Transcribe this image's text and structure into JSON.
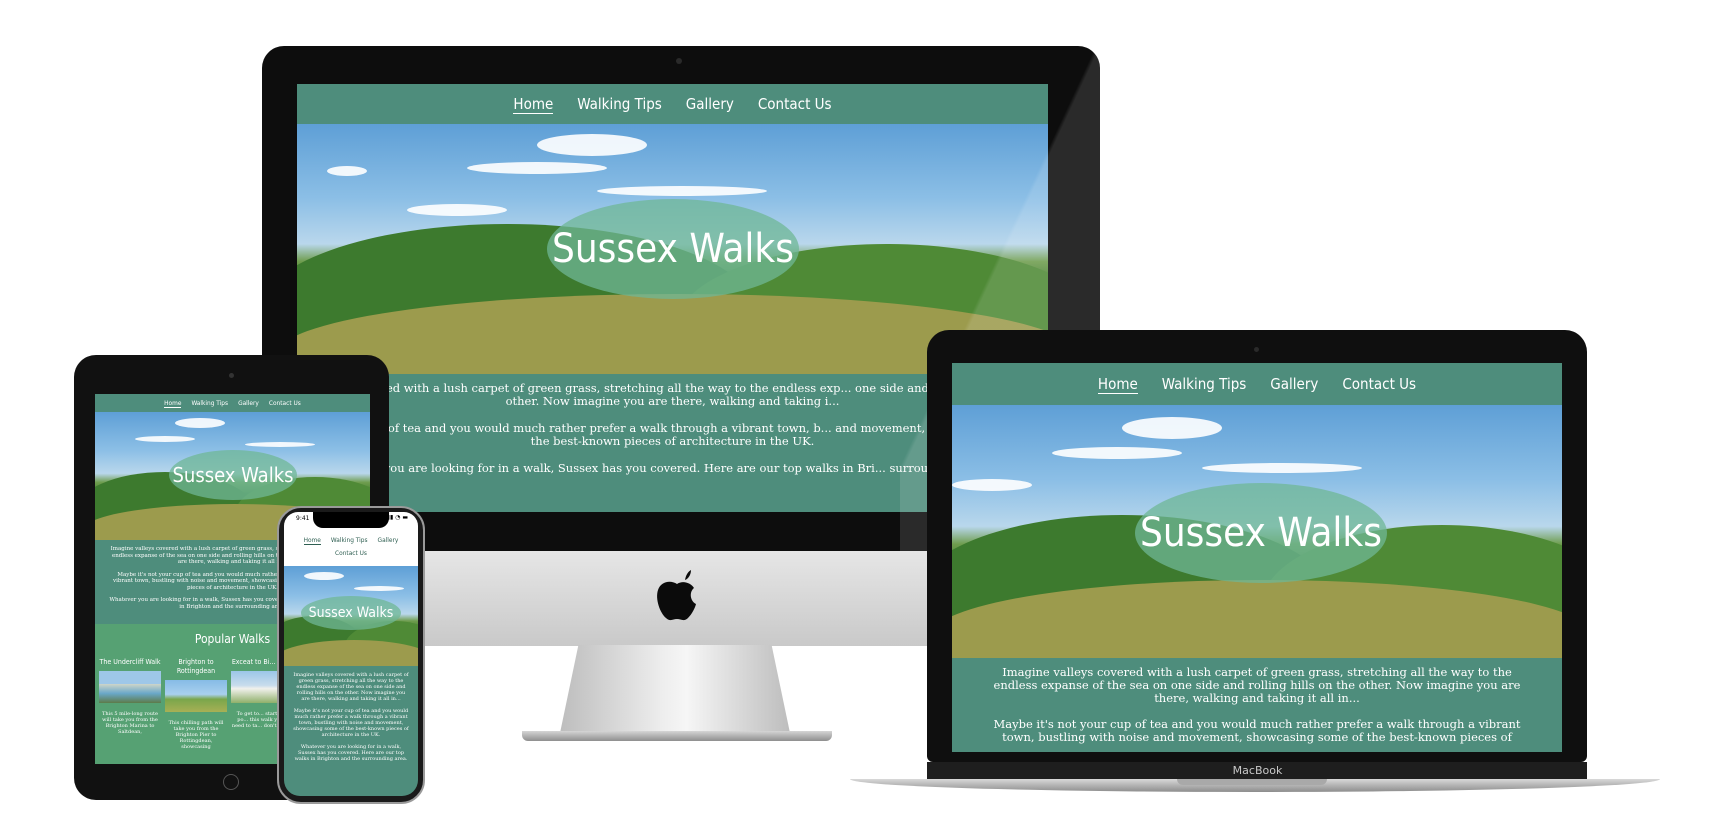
{
  "site": {
    "nav": {
      "home": "Home",
      "walking_tips": "Walking Tips",
      "gallery": "Gallery",
      "contact": "Contact Us"
    },
    "hero_title": "Sussex Walks",
    "intro": {
      "p1": "Imagine valleys covered with a lush carpet of green grass, stretching all the way to the endless expanse of the sea on one side and rolling hills on the other. Now imagine you are there, walking and taking it all in...",
      "p2": "Maybe it's not your cup of tea and you would much rather prefer a walk through a vibrant town, bustling with noise and movement, showcasing some of the best-known pieces of architecture in the UK.",
      "p3": "Whatever you are looking for in a walk, Sussex has you covered. Here are our top walks in Brighton and the surrounding area."
    },
    "imac_intro": {
      "p1": "...alleys covered with a lush carpet of green grass, stretching all the way to the endless exp... one side and rolling hills on the other. Now imagine you are there, walking and taking i...",
      "p2": "...not your cup of tea and you would much rather prefer a walk through a vibrant town, b... and movement, showcasing some of the best-known pieces of architecture in the UK.",
      "p3": "...ver you are looking for in a walk, Sussex has you covered. Here are our top walks in Bri... surrounding area."
    },
    "macbook_intro": {
      "p1": "Imagine valleys covered with a lush carpet of green grass, stretching all the way to the endless expanse of the sea on one side and rolling hills on the other. Now imagine you are there, walking and taking it all in...",
      "p2": "Maybe it's not your cup of tea and you would much rather prefer a walk through a vibrant town, bustling with noise and movement, showcasing some of the best-known pieces of"
    },
    "popular": {
      "title": "Popular Walks",
      "walks": [
        {
          "title": "The Undercliff Walk",
          "desc": "This 5 mile-long route will take you from the Brighton Marina to Saltdean,"
        },
        {
          "title": "Brighton to Rottingdean",
          "desc": "This chilling path will take you from the Brighton Pier to Rottingdean, showcasing"
        },
        {
          "title": "Exceat to Bi... Gap",
          "desc": "To get to... starting po... this walk yo... need to ta... don't wo..."
        }
      ]
    }
  },
  "devices": {
    "macbook_label": "MacBook",
    "iphone_time": "9:41"
  },
  "colors": {
    "site_green": "#4e8d7c",
    "popular_green": "#56a173",
    "oval": "#6fb796"
  }
}
